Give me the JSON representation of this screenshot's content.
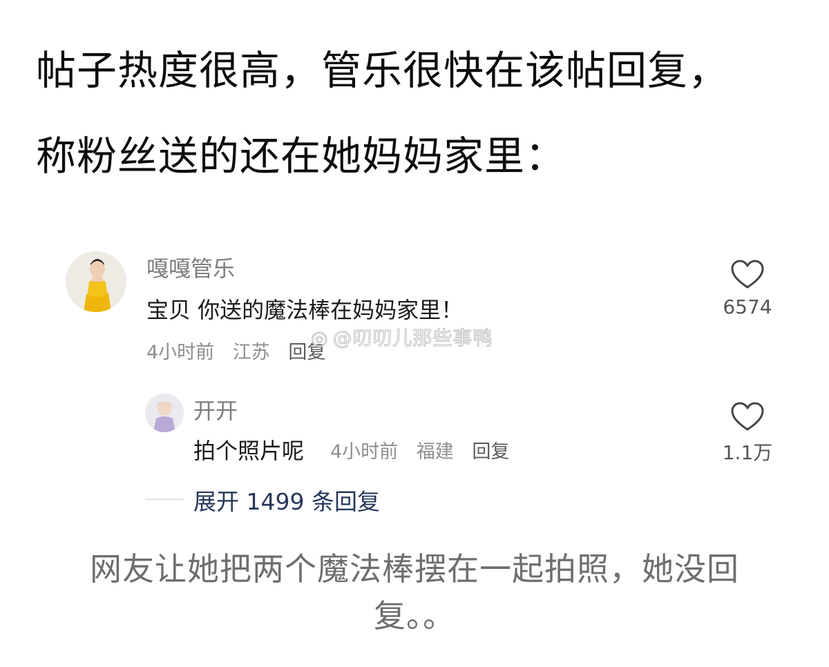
{
  "headline": {
    "line1": "帖子热度很高，管乐很快在该帖回复，",
    "line2": "称粉丝送的还在她妈妈家里："
  },
  "comment": {
    "username": "嘎嘎管乐",
    "text": "宝贝 你送的魔法棒在妈妈家里！",
    "time": "4小时前",
    "location": "江苏",
    "reply_label": "回复",
    "like_count": "6574"
  },
  "reply": {
    "username": "开开",
    "text": "拍个照片呢",
    "time": "4小时前",
    "location": "福建",
    "reply_label": "回复",
    "like_count": "1.1万"
  },
  "expand_label": "展开 1499 条回复",
  "watermark": "@叨叨儿那些事鸭",
  "caption": "网友让她把两个魔法棒摆在一起拍照，她没回复。。",
  "colors": {
    "expand": "#26385a",
    "meta": "#8e8e8e",
    "username": "#7d7d7d"
  },
  "icons": {
    "like": "heart-outline-icon",
    "watermark": "weibo-icon"
  }
}
